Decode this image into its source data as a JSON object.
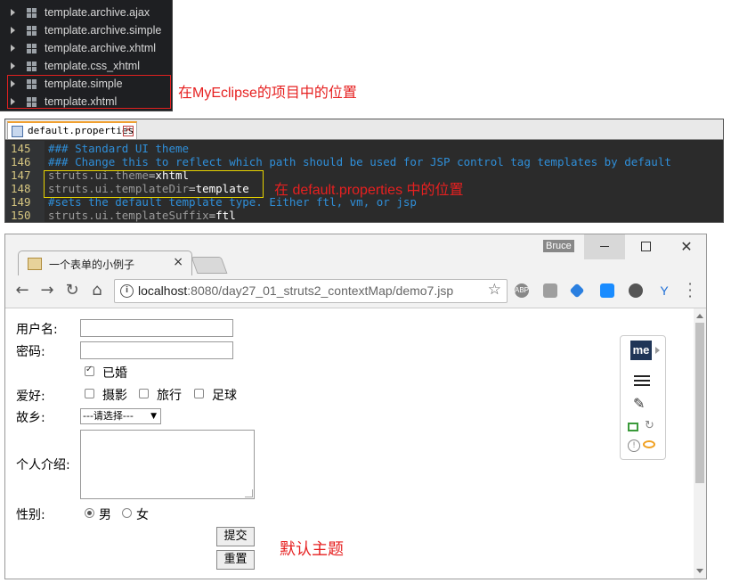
{
  "project_tree": {
    "items": [
      {
        "label": "template.archive.ajax"
      },
      {
        "label": "template.archive.simple"
      },
      {
        "label": "template.archive.xhtml"
      },
      {
        "label": "template.css_xhtml"
      },
      {
        "label": "template.simple"
      },
      {
        "label": "template.xhtml"
      }
    ],
    "annotation": "在MyEclipse的项目中的位置"
  },
  "editor": {
    "tab_label": "default.properties",
    "lines": [
      {
        "number": "145",
        "comment": "### Standard UI theme"
      },
      {
        "number": "146",
        "comment": "### Change this to reflect which path should be used for JSP control tag templates by default"
      },
      {
        "number": "147",
        "key": "struts.ui.theme",
        "eq": "=",
        "value": "xhtml"
      },
      {
        "number": "148",
        "key": "struts.ui.templateDir",
        "eq": "=",
        "value": "template"
      },
      {
        "number": "149",
        "comment": "#sets the default template type. Either ftl, vm, or jsp"
      },
      {
        "number": "150",
        "key": "struts.ui.templateSuffix",
        "eq": "=",
        "value": "ftl"
      }
    ],
    "annotation": "在 default.properties 中的位置"
  },
  "browser": {
    "tab_title": "一个表单的小例子",
    "tab_close": "×",
    "user": "Bruce",
    "close_glyph": "✕",
    "url_host": "localhost",
    "url_path": ":8080/day27_01_struts2_contextMap/demo7.jsp",
    "nav": {
      "back": "←",
      "forward": "→",
      "reload": "↻",
      "home": "⌂"
    },
    "extensions": [
      {
        "name": "abp-icon",
        "label": "ABP",
        "color": "#888888"
      },
      {
        "name": "grid-icon",
        "label": "",
        "color": "#9e9e9e"
      },
      {
        "name": "blue-arrow-icon",
        "label": "",
        "color": "#2a7fe0"
      },
      {
        "name": "arrow-box-icon",
        "label": "",
        "color": "#1a8cff"
      },
      {
        "name": "evernote-icon",
        "label": "",
        "color": "#555555"
      },
      {
        "name": "y-icon",
        "label": "",
        "color": "#1f6fd6"
      }
    ]
  },
  "form": {
    "username_label": "用户名:",
    "password_label": "密码:",
    "married_label": "已婚",
    "married_checked": true,
    "hobby_label": "爱好:",
    "hobbies": [
      "摄影",
      "旅行",
      "足球"
    ],
    "hometown_label": "故乡:",
    "hometown_selected": "---请选择---",
    "intro_label": "个人介绍:",
    "gender_label": "性别:",
    "genders": [
      "男",
      "女"
    ],
    "gender_selected": "男",
    "submit_label": "提交",
    "reset_label": "重置",
    "theme_note": "默认主题"
  },
  "ext_panel": {
    "me_label": "me"
  }
}
